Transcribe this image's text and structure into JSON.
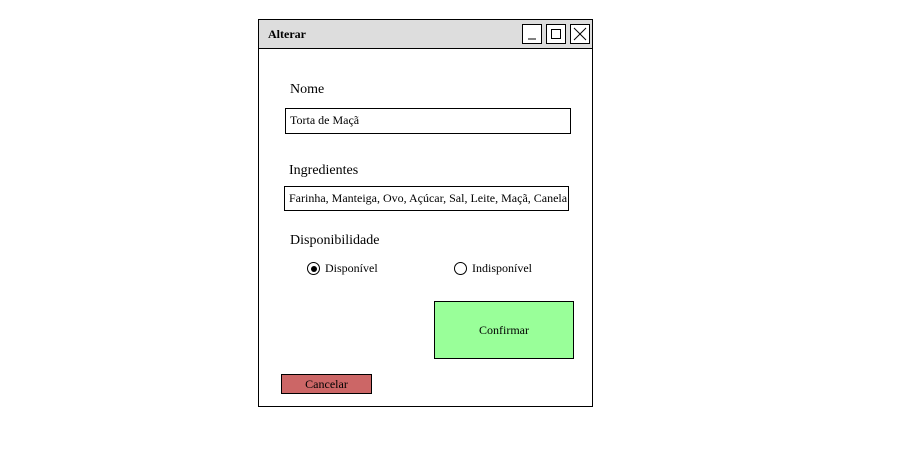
{
  "window": {
    "title": "Alterar",
    "controls": [
      "minimize-icon",
      "maximize-icon",
      "close-icon"
    ]
  },
  "form": {
    "name_label": "Nome",
    "name_value": "Torta de Maçã",
    "ingredients_label": "Ingredientes",
    "ingredients_value": "Farinha, Manteiga, Ovo, Açúcar, Sal, Leite, Maçã, Canela",
    "availability_label": "Disponibilidade",
    "options": [
      {
        "label": "Disponível",
        "selected": true
      },
      {
        "label": "Indisponível",
        "selected": false
      }
    ]
  },
  "buttons": {
    "confirm_label": "Confirmar",
    "cancel_label": "Cancelar"
  },
  "colors": {
    "titlebar": "#dddddd",
    "confirm": "#99ff99",
    "cancel": "#cc6666"
  }
}
